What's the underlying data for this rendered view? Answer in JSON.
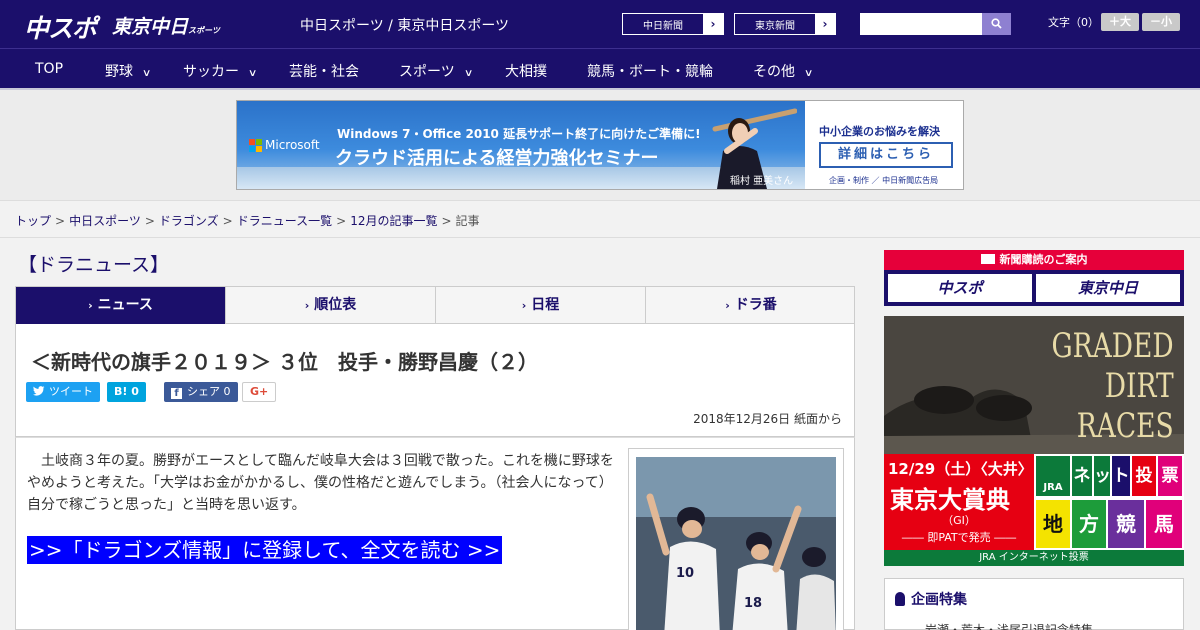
{
  "header": {
    "logo_main": "中スポ",
    "logo_tokyo": "東京中日",
    "logo_tokyo_small": "スポーツ",
    "site_title": "中日スポーツ / 東京中日スポーツ",
    "ext_links": [
      {
        "label": "中日新聞",
        "arrow": "›"
      },
      {
        "label": "東京新聞",
        "arrow": "›"
      }
    ],
    "search": {
      "placeholder": ""
    },
    "font_size_label": "文字（0）",
    "font_size_up": "＋大",
    "font_size_down": "－小"
  },
  "nav": {
    "items": [
      {
        "label": "TOP",
        "has_menu": false
      },
      {
        "label": "野球",
        "has_menu": true
      },
      {
        "label": "サッカー",
        "has_menu": true
      },
      {
        "label": "芸能・社会",
        "has_menu": false
      },
      {
        "label": "スポーツ",
        "has_menu": true
      },
      {
        "label": "大相撲",
        "has_menu": false
      },
      {
        "label": "競馬・ボート・競輪",
        "has_menu": false
      },
      {
        "label": "その他",
        "has_menu": true
      }
    ],
    "chevron": "∨"
  },
  "ad": {
    "brand": "Microsoft",
    "line1": "Windows 7・Office 2010 延長サポート終了に向けたご準備に!",
    "line2": "クラウド活用による経営力強化セミナー",
    "caption": "稲村 亜美さん",
    "right_line1": "中小企業のお悩みを解決",
    "right_button": "詳細はこちら",
    "right_note": "企画・制作 ／ 中日新聞広告局"
  },
  "breadcrumb": {
    "links": [
      "トップ",
      "中日スポーツ",
      "ドラゴンズ",
      "ドラニュース一覧",
      "12月の記事一覧"
    ],
    "separator": ">",
    "current": "記事"
  },
  "section_title": "【ドラニュース】",
  "tabs": [
    {
      "label": "ニュース",
      "active": true
    },
    {
      "label": "順位表",
      "active": false
    },
    {
      "label": "日程",
      "active": false
    },
    {
      "label": "ドラ番",
      "active": false
    }
  ],
  "tab_chevron": "›",
  "article": {
    "title": "＜新時代の旗手２０１９＞ ３位　投手・勝野昌慶（２）",
    "share": {
      "tweet": "ツイート",
      "hatena": "B!  0",
      "facebook": "シェア 0",
      "google": "G+"
    },
    "date": "2018年12月26日 紙面から",
    "body": "　土岐商３年の夏。勝野がエースとして臨んだ岐阜大会は３回戦で散った。これを機に野球をやめようと考えた。「大学はお金がかかるし、僕の性格だと遊んでしまう。（社会人になって）自分で稼ごうと思った」と当時を思い返す。",
    "read_more": ">>「ドラゴンズ情報」に登録して、全文を読む >>",
    "photo_numbers": [
      "10",
      "18"
    ]
  },
  "sidebar": {
    "subscribe_head": "新聞購読のご案内",
    "subscribe_logos": [
      "中スポ",
      "東京中日"
    ],
    "jra": {
      "title_lines": [
        "GRADED",
        "DIRT",
        "RACES"
      ],
      "date": "12/29（土）〈大井〉",
      "race": "東京大賞典",
      "grade": "（GⅠ）",
      "pat": "―― 即PATで発売 ――",
      "cells": [
        "ネ",
        "ッ",
        "ト",
        "投",
        "票",
        "地",
        "方",
        "競",
        "馬"
      ],
      "brand": "JRA",
      "footer": "JRA インターネット投票"
    },
    "feature_head": "企画特集",
    "feature_sub": "岩瀬・荒木・浅尾引退記念特集"
  },
  "colors": {
    "brand_navy": "#1b0f6b",
    "read_more_bg": "#0000ff",
    "jra_red": "#e60012"
  }
}
